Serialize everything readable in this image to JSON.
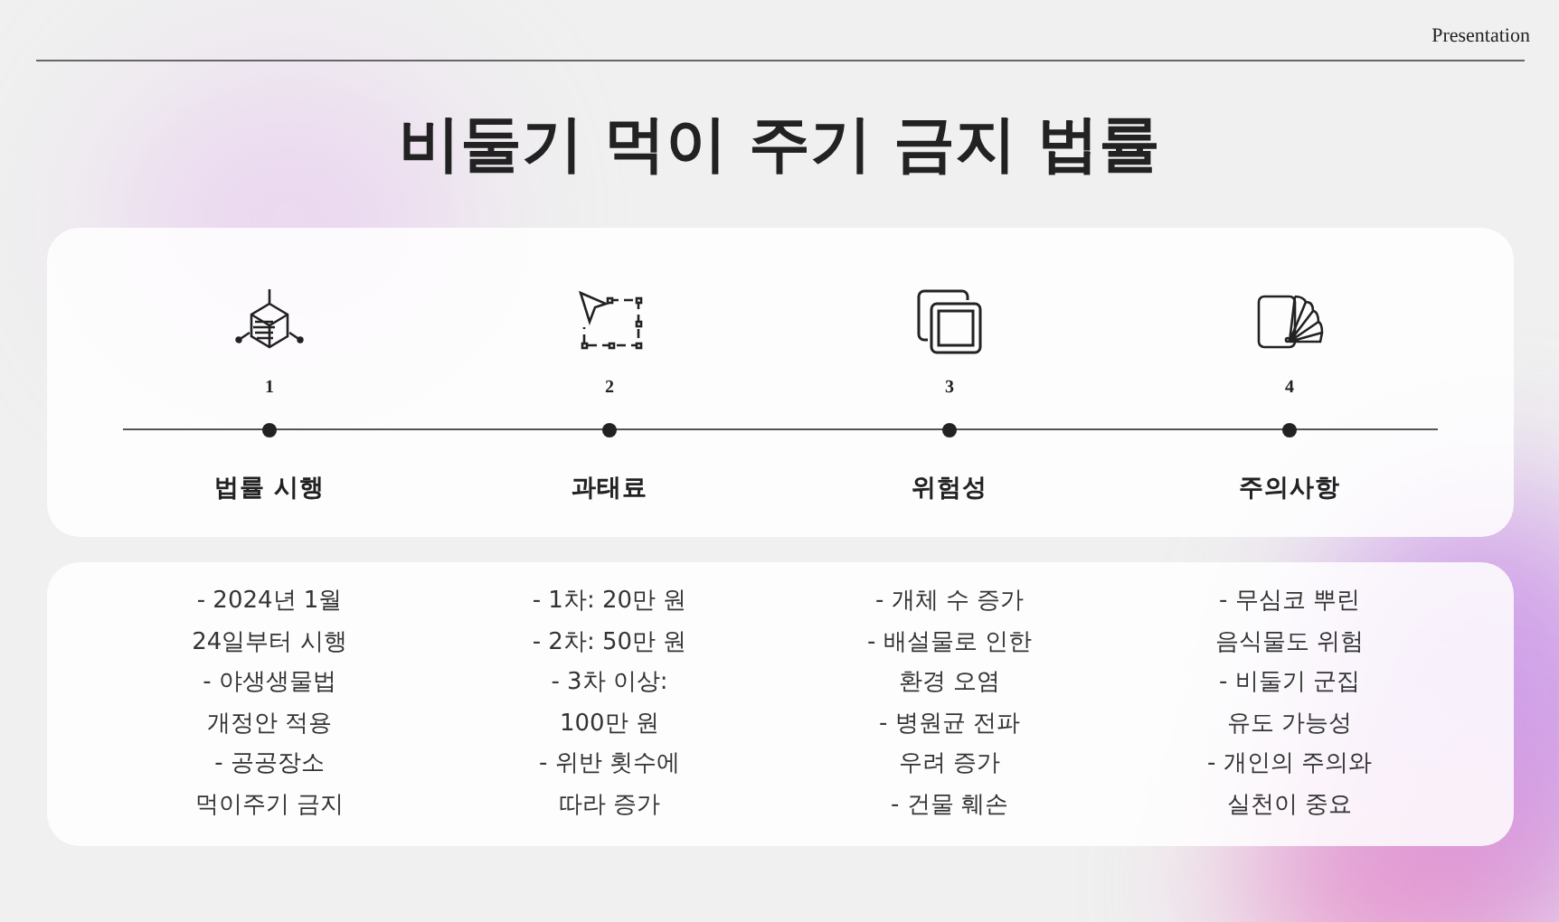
{
  "header": {
    "label": "Presentation"
  },
  "title": "비둘기 먹이 주기 금지 법률",
  "steps": [
    {
      "kind": "cube",
      "number": "1",
      "label": "법률 시행",
      "lines": [
        "- 2024년 1월",
        "24일부터 시행",
        "- 야생생물법",
        "개정안 적용",
        "- 공공장소",
        "먹이주기 금지"
      ]
    },
    {
      "kind": "select",
      "number": "2",
      "label": "과태료",
      "lines": [
        "- 1차: 20만 원",
        "- 2차: 50만 원",
        "- 3차 이상:",
        "100만 원",
        "- 위반 횟수에",
        "따라 증가"
      ]
    },
    {
      "kind": "layers",
      "number": "3",
      "label": "위험성",
      "lines": [
        "- 개체 수 증가",
        "- 배설물로 인한",
        "환경 오염",
        "- 병원균 전파",
        "우려 증가",
        "- 건물 훼손"
      ]
    },
    {
      "kind": "swatch",
      "number": "4",
      "label": "주의사항",
      "lines": [
        "- 무심코 뿌린",
        "음식물도 위험",
        "- 비둘기 군집",
        "유도 가능성",
        "- 개인의 주의와",
        "실천이 중요"
      ]
    }
  ]
}
